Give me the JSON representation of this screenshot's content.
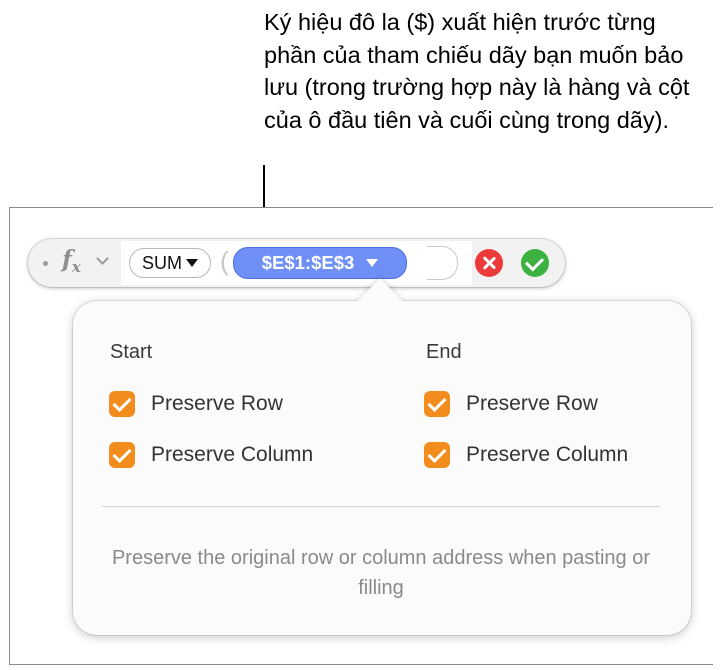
{
  "callout": {
    "text": "Ký hiệu đô la ($) xuất hiện trước từng phần của tham chiếu dãy bạn muốn bảo lưu (trong trường hợp này là hàng và cột của ô đầu tiên và cuối cùng trong dãy)."
  },
  "formula_bar": {
    "fx_label": "f",
    "fx_sub": "x",
    "function_token": "SUM",
    "reference_token": "$E$1:$E$3",
    "icons": {
      "dot": "drag-handle-dot-icon",
      "chevron": "chevron-down-icon",
      "cancel": "cancel-x-icon",
      "accept": "checkmark-icon"
    },
    "colors": {
      "reference_token": "#6d8ff6",
      "cancel": "#ec3a3a",
      "accept": "#3db13f"
    }
  },
  "popover": {
    "start": {
      "heading": "Start",
      "preserve_row": {
        "label": "Preserve Row",
        "checked": true
      },
      "preserve_column": {
        "label": "Preserve Column",
        "checked": true
      }
    },
    "end": {
      "heading": "End",
      "preserve_row": {
        "label": "Preserve Row",
        "checked": true
      },
      "preserve_column": {
        "label": "Preserve Column",
        "checked": true
      }
    },
    "hint": "Preserve the original row or column address when pasting or filling",
    "checkbox_color": "#f28c1d"
  }
}
